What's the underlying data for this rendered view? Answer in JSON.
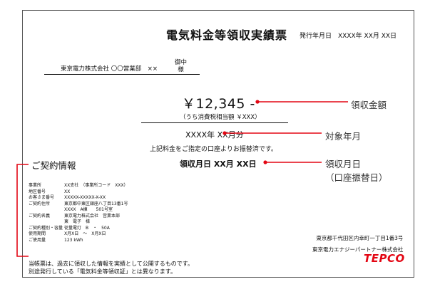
{
  "document": {
    "title": "電気料金等領収実績票",
    "issue_date": "発行年月日　XXXX年 XX月 XX日",
    "addressee": "東京電力株式会社 〇〇営業部　××",
    "honorific_top": "御中",
    "honorific_bottom": "様",
    "amount": "￥12,345 -",
    "tax": "（うち消費税相当額 ￥XXX）",
    "period": "XXXX年 XX月分",
    "note": "上記料金をご指定の口座よりお振替済です。",
    "receipt_date": "領収月日 XX月 XX日"
  },
  "contract": {
    "heading": "ご契約情報",
    "rows": [
      {
        "label": "事業所",
        "value": "XX支社　（事業所コード　XXX）"
      },
      {
        "label": "地区番号",
        "value": "XX"
      },
      {
        "label": "お客さま番号",
        "value": "XXXXX-XXXXX-X-XX"
      },
      {
        "label": "ご契約住所",
        "value": "東京都中東区銀座八丁目13番1号"
      },
      {
        "label": "",
        "value": "XXXX　A棟　　501号室"
      },
      {
        "label": "ご契約名義",
        "value": "東京電力株式会社　営業本部"
      },
      {
        "label": "",
        "value": "東　電子　様"
      },
      {
        "label": "ご契約種別・容量",
        "value": "従量電灯　B　・　50A"
      },
      {
        "label": "使用期間",
        "value": "X月X日　～　X月X日"
      },
      {
        "label": "ご使用量",
        "value": "123 kWh"
      }
    ]
  },
  "company": {
    "address": "東京都千代田区内幸町一丁目1番3号",
    "name": "東京電力エナジーパートナー株式会社",
    "logo_text": "TEPCO"
  },
  "footer": {
    "line1": "当帳票は、過去に領収した情報を実績として公開するものです。",
    "line2": "別途発行している「電気料金等領収証」とは異なります。"
  },
  "callouts": {
    "amount": "領収金額",
    "period": "対象年月",
    "receipt_line1": "領収月日",
    "receipt_line2": "（口座振替日）"
  },
  "colors": {
    "accent": "#e30613",
    "border": "#555555"
  }
}
